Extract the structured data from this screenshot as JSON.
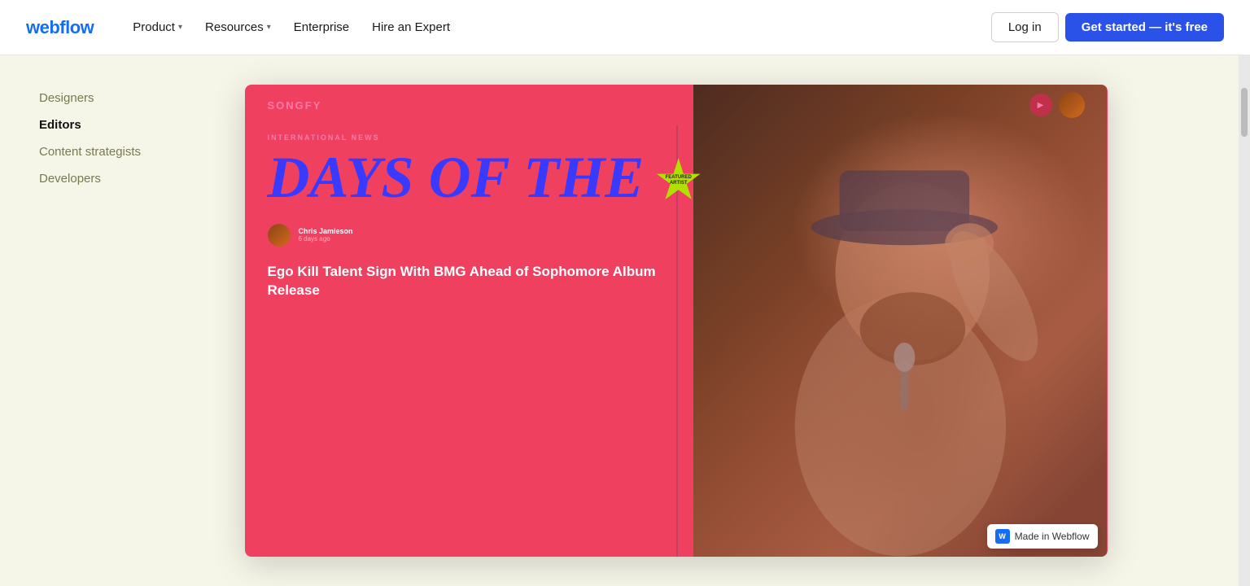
{
  "nav": {
    "logo": "webflow",
    "links": [
      {
        "id": "product",
        "label": "Product",
        "hasDropdown": true
      },
      {
        "id": "resources",
        "label": "Resources",
        "hasDropdown": true
      },
      {
        "id": "enterprise",
        "label": "Enterprise",
        "hasDropdown": false
      },
      {
        "id": "hire-expert",
        "label": "Hire an Expert",
        "hasDropdown": false
      }
    ],
    "login_label": "Log in",
    "signup_label": "Get started — it's free"
  },
  "sidebar": {
    "items": [
      {
        "id": "designers",
        "label": "Designers",
        "active": false
      },
      {
        "id": "editors",
        "label": "Editors",
        "active": true
      },
      {
        "id": "content-strategists",
        "label": "Content strategists",
        "active": false
      },
      {
        "id": "developers",
        "label": "Developers",
        "active": false
      }
    ]
  },
  "preview": {
    "songfy": {
      "logo": "SONGFY",
      "category": "INTERNATIONAL NEWS",
      "headline": "DAYS OF THE",
      "badge_line1": "FEATURED",
      "badge_line2": "ARTIST",
      "author_name": "Chris Jamieson",
      "author_date": "6 days ago",
      "article_title": "Ego Kill Talent Sign With BMG Ahead of Sophomore Album Release"
    }
  },
  "made_in_webflow": {
    "icon": "W",
    "label": "Made in Webflow"
  }
}
